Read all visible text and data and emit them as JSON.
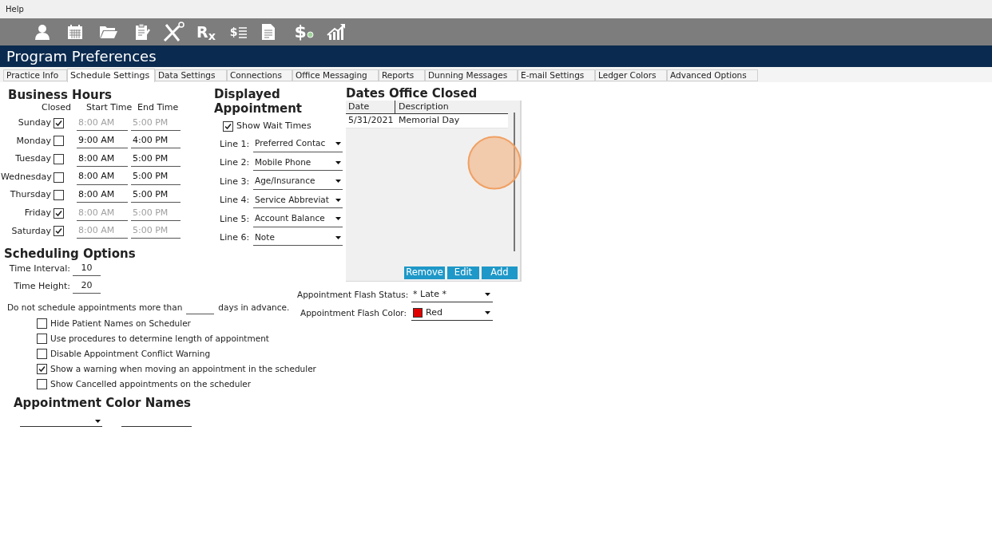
{
  "menu": [
    "Help"
  ],
  "toolbar": [
    {
      "kind": "person"
    },
    {
      "kind": "calendar"
    },
    {
      "kind": "folder"
    },
    {
      "kind": "clipboard"
    },
    {
      "kind": "tools"
    },
    {
      "kind": "rx",
      "glyph": "R$_{x}$"
    },
    {
      "kind": "ledger",
      "glyph": "$"
    },
    {
      "kind": "document"
    },
    {
      "kind": "dollar",
      "glyph": "$"
    },
    {
      "kind": "chart"
    }
  ],
  "window": {
    "title": "Program Preferences"
  },
  "tabs": [
    {
      "label": "Practice Info",
      "selected": false
    },
    {
      "label": "Schedule Settings",
      "selected": true
    },
    {
      "label": "Data Settings",
      "selected": false
    },
    {
      "label": "Connections",
      "selected": false
    },
    {
      "label": "Office Messaging",
      "selected": false
    },
    {
      "label": "Reports",
      "selected": false
    },
    {
      "label": "Dunning Messages",
      "selected": false
    },
    {
      "label": "E-mail Settings",
      "selected": false
    },
    {
      "label": "Ledger Colors",
      "selected": false
    },
    {
      "label": "Advanced Options",
      "selected": false
    }
  ],
  "business_hours": {
    "title": "Business Hours",
    "columns": [
      "Closed",
      "Start Time",
      "End Time"
    ],
    "days": [
      {
        "day": "Sunday",
        "closed": true,
        "start": "8:00 AM",
        "end": "5:00 PM"
      },
      {
        "day": "Monday",
        "closed": false,
        "start": "9:00 AM",
        "end": "4:00 PM"
      },
      {
        "day": "Tuesday",
        "closed": false,
        "start": "8:00 AM",
        "end": "5:00 PM"
      },
      {
        "day": "Wednesday",
        "closed": false,
        "start": "8:00 AM",
        "end": "5:00 PM"
      },
      {
        "day": "Thursday",
        "closed": false,
        "start": "8:00 AM",
        "end": "5:00 PM"
      },
      {
        "day": "Friday",
        "closed": true,
        "start": "8:00 AM",
        "end": "5:00 PM"
      },
      {
        "day": "Saturday",
        "closed": true,
        "start": "8:00 AM",
        "end": "5:00 PM"
      }
    ]
  },
  "displayed_appointment": {
    "title": "Displayed Appointment",
    "show_wait_times": {
      "label": "Show Wait Times",
      "checked": true
    },
    "lines": [
      {
        "label": "Line 1:",
        "value": "Preferred Contac"
      },
      {
        "label": "Line 2:",
        "value": "Mobile Phone"
      },
      {
        "label": "Line 3:",
        "value": "Age/Insurance"
      },
      {
        "label": "Line 4:",
        "value": "Service Abbreviat"
      },
      {
        "label": "Line 5:",
        "value": "Account Balance"
      },
      {
        "label": "Line 6:",
        "value": "Note"
      }
    ]
  },
  "dates_office_closed": {
    "title": "Dates Office Closed",
    "columns": [
      "Date",
      "Description"
    ],
    "rows": [
      {
        "date": "5/31/2021",
        "description": "Memorial Day"
      }
    ],
    "buttons": [
      "Remove",
      "Edit",
      "Add"
    ]
  },
  "scheduling_options": {
    "title": "Scheduling Options",
    "fields": [
      {
        "label": "Time Interval:",
        "value": "10"
      },
      {
        "label": "Time Height:",
        "value": "20"
      }
    ]
  },
  "advance_days": {
    "before": "Do not schedule appointments more than",
    "after": "days in advance."
  },
  "options": [
    {
      "label": "Hide Patient Names on Scheduler",
      "checked": false
    },
    {
      "label": "Use procedures to determine length of appointment",
      "checked": false
    },
    {
      "label": "Disable Appointment Conflict Warning",
      "checked": false
    },
    {
      "label": "Show a warning when moving an appointment in the scheduler",
      "checked": true
    },
    {
      "label": "Show Cancelled appointments on the scheduler",
      "checked": false
    }
  ],
  "flash_status": {
    "label": "Appointment Flash Status:",
    "value": "* Late *"
  },
  "flash_color": {
    "label": "Appointment Flash Color:",
    "value": "Red",
    "color": "#e00000"
  },
  "appointment_color_names": {
    "title": "Appointment Color Names"
  }
}
